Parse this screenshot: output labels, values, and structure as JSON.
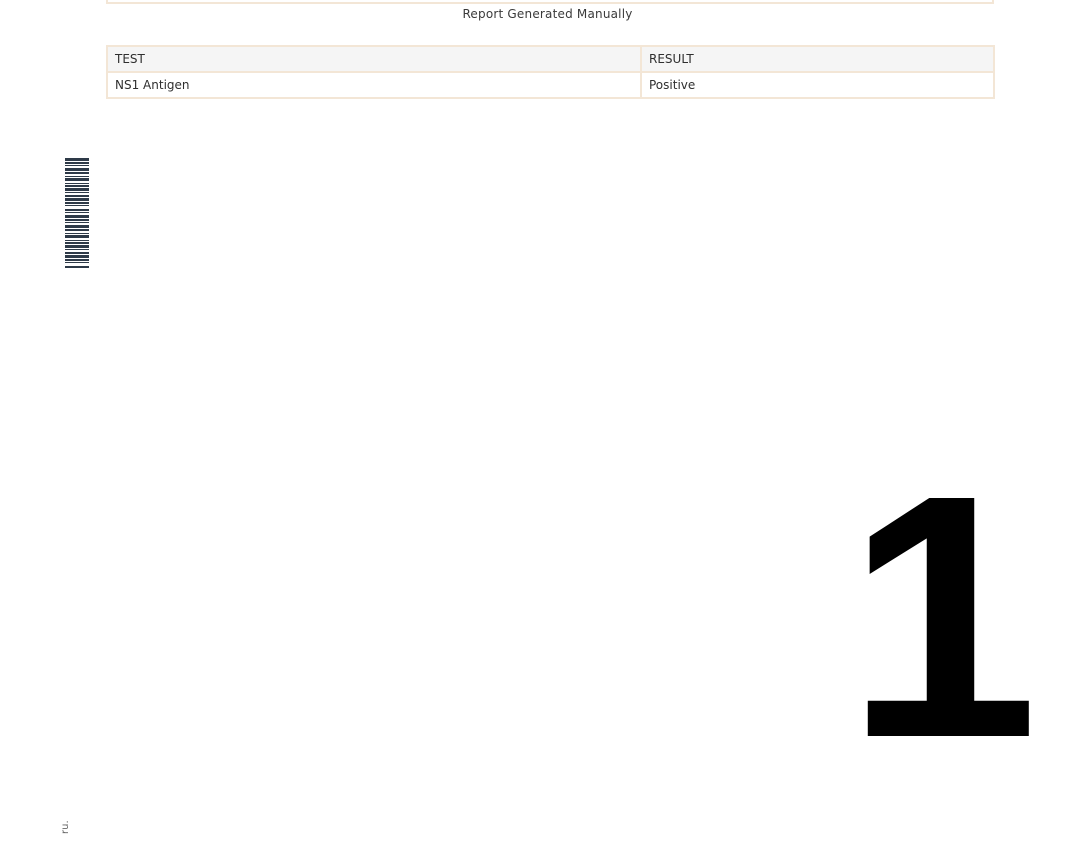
{
  "report": {
    "footer_note": "Report Generated Manually"
  },
  "results_table": {
    "headers": [
      "TEST",
      "RESULT"
    ],
    "rows": [
      [
        "NS1 Antigen",
        "Positive"
      ]
    ]
  },
  "barcode": {
    "icon": "barcode-icon",
    "color": "#2e3a48"
  },
  "page": {
    "number": "1"
  },
  "edge_text": "ru."
}
